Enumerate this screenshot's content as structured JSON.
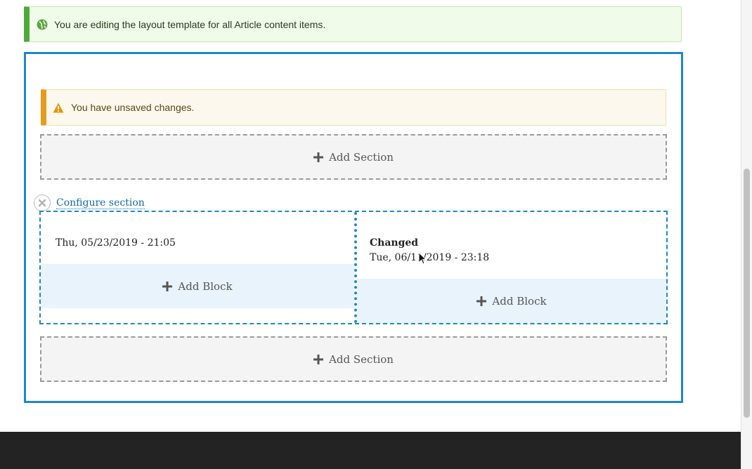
{
  "status_message": {
    "text": "You are editing the layout template for all Article content items.",
    "icon": "globe-icon",
    "color": "#4ea93b"
  },
  "warning_message": {
    "text": "You have unsaved changes.",
    "icon": "warning-icon",
    "color": "#e59b1c"
  },
  "add_section_label": "Add Section",
  "configure_section_label": "Configure section",
  "section": {
    "region_first": {
      "date_value": "Thu, 05/23/2019 - 21:05",
      "add_block_label": "Add Block"
    },
    "region_second": {
      "field_label": "Changed",
      "date_value": "Tue, 06/11/2019 - 23:18",
      "add_block_label": "Add Block"
    }
  },
  "colors": {
    "accent": "#1f87c8",
    "link": "#0e6aa9",
    "footer": "#232323"
  }
}
